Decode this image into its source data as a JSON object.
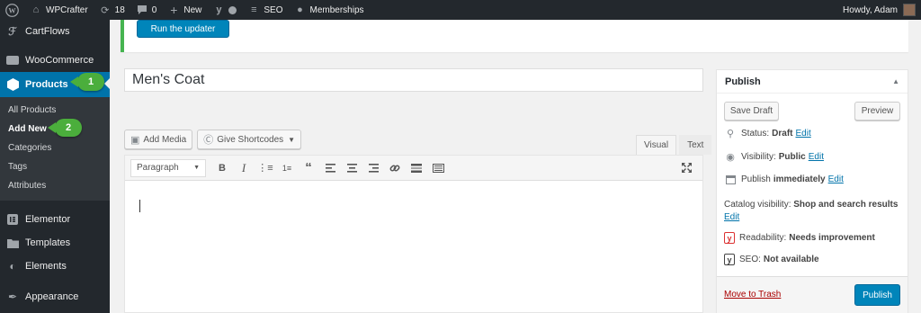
{
  "adminbar": {
    "site_name": "WPCrafter",
    "updates_count": "18",
    "comments_count": "0",
    "new_label": "New",
    "seo_label": "SEO",
    "memberships_label": "Memberships",
    "howdy": "Howdy, Adam"
  },
  "sidebar": {
    "items_top": [
      {
        "label": "CartFlows",
        "icon": "cartflows-icon"
      },
      {
        "label": "WooCommerce",
        "icon": "woocommerce-icon"
      },
      {
        "label": "Products",
        "icon": "products-icon"
      }
    ],
    "submenu": [
      "All Products",
      "Add New",
      "Categories",
      "Tags",
      "Attributes"
    ],
    "items_bottom": [
      {
        "label": "Elementor",
        "icon": "elementor-icon"
      },
      {
        "label": "Templates",
        "icon": "folder-icon"
      },
      {
        "label": "Elements",
        "icon": "elements-icon"
      },
      {
        "label": "Appearance",
        "icon": "brush-icon"
      }
    ],
    "badges": [
      "1",
      "2"
    ]
  },
  "notice": {
    "button_label": "Run the updater"
  },
  "title_value": "Men's Coat",
  "media": {
    "add_media": "Add Media",
    "give_shortcodes": "Give Shortcodes"
  },
  "editor": {
    "tabs": [
      "Visual",
      "Text"
    ],
    "format_select": "Paragraph"
  },
  "publish": {
    "title": "Publish",
    "save_draft": "Save Draft",
    "preview": "Preview",
    "status_label": "Status:",
    "status_value": "Draft",
    "visibility_label": "Visibility:",
    "visibility_value": "Public",
    "publish_label": "Publish",
    "publish_value": "immediately",
    "catalog_label": "Catalog visibility:",
    "catalog_value": "Shop and search results",
    "readability_label": "Readability:",
    "readability_value": "Needs improvement",
    "seo_label": "SEO:",
    "seo_value": "Not available",
    "edit": "Edit",
    "trash": "Move to Trash",
    "publish_button": "Publish"
  },
  "colors": {
    "accent": "#0073aa",
    "button": "#0085ba",
    "badge": "#4bae3c",
    "notice": "#46b450",
    "trash": "#aa0000"
  }
}
